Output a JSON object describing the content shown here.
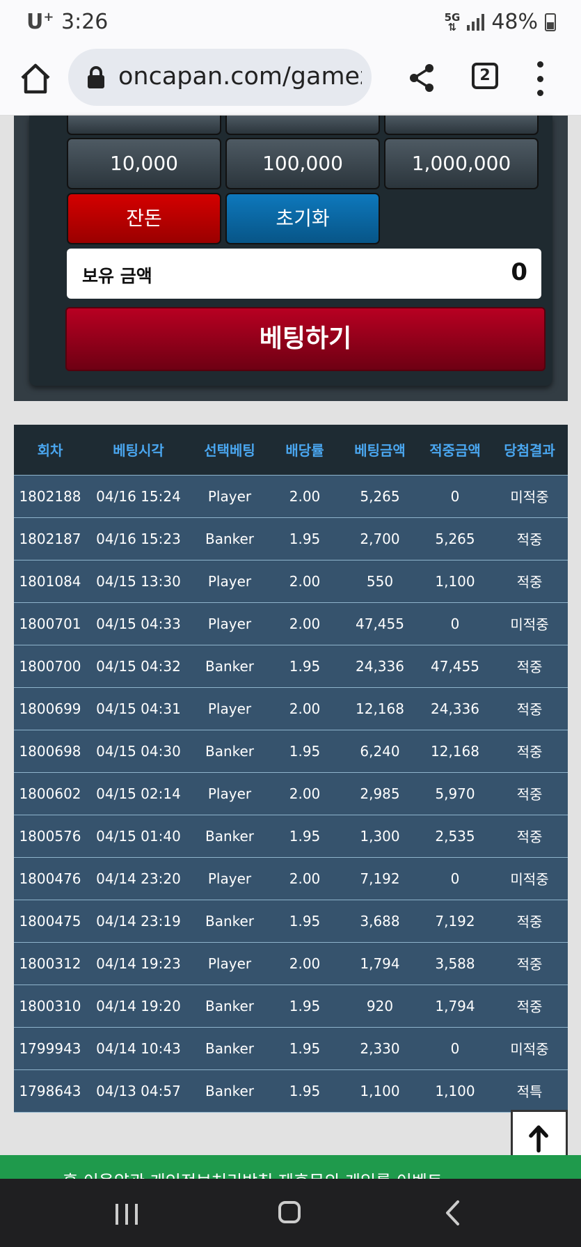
{
  "status_bar": {
    "carrier": "U",
    "carrier_sup": "+",
    "time": "3:26",
    "network_top": "5G",
    "network_bottom": "⇅",
    "battery": "48%",
    "icons": [
      "network-5g-icon",
      "signal-icon",
      "battery-icon"
    ]
  },
  "browser": {
    "url": "oncapan.com/gamezc",
    "tab_count": "2",
    "icons": [
      "home-icon",
      "lock-icon",
      "share-icon",
      "tabs-icon",
      "more-vert-icon"
    ]
  },
  "betting_panel": {
    "chips": [
      "10,000",
      "100,000",
      "1,000,000"
    ],
    "change_label": "잔돈",
    "reset_label": "초기화",
    "balance_label": "보유 금액",
    "balance_value": "0",
    "bet_label": "베팅하기"
  },
  "history": {
    "headers": [
      "회차",
      "베팅시각",
      "선택베팅",
      "배당률",
      "베팅금액",
      "적중금액",
      "당첨결과"
    ],
    "rows": [
      {
        "round": "1802188",
        "time": "04/16 15:24",
        "pick": "Player",
        "odds": "2.00",
        "bet": "5,265",
        "win": "0",
        "result": "미적중"
      },
      {
        "round": "1802187",
        "time": "04/16 15:23",
        "pick": "Banker",
        "odds": "1.95",
        "bet": "2,700",
        "win": "5,265",
        "result": "적중"
      },
      {
        "round": "1801084",
        "time": "04/15 13:30",
        "pick": "Player",
        "odds": "2.00",
        "bet": "550",
        "win": "1,100",
        "result": "적중"
      },
      {
        "round": "1800701",
        "time": "04/15 04:33",
        "pick": "Player",
        "odds": "2.00",
        "bet": "47,455",
        "win": "0",
        "result": "미적중"
      },
      {
        "round": "1800700",
        "time": "04/15 04:32",
        "pick": "Banker",
        "odds": "1.95",
        "bet": "24,336",
        "win": "47,455",
        "result": "적중"
      },
      {
        "round": "1800699",
        "time": "04/15 04:31",
        "pick": "Player",
        "odds": "2.00",
        "bet": "12,168",
        "win": "24,336",
        "result": "적중"
      },
      {
        "round": "1800698",
        "time": "04/15 04:30",
        "pick": "Banker",
        "odds": "1.95",
        "bet": "6,240",
        "win": "12,168",
        "result": "적중"
      },
      {
        "round": "1800602",
        "time": "04/15 02:14",
        "pick": "Player",
        "odds": "2.00",
        "bet": "2,985",
        "win": "5,970",
        "result": "적중"
      },
      {
        "round": "1800576",
        "time": "04/15 01:40",
        "pick": "Banker",
        "odds": "1.95",
        "bet": "1,300",
        "win": "2,535",
        "result": "적중"
      },
      {
        "round": "1800476",
        "time": "04/14 23:20",
        "pick": "Player",
        "odds": "2.00",
        "bet": "7,192",
        "win": "0",
        "result": "미적중"
      },
      {
        "round": "1800475",
        "time": "04/14 23:19",
        "pick": "Banker",
        "odds": "1.95",
        "bet": "3,688",
        "win": "7,192",
        "result": "적중"
      },
      {
        "round": "1800312",
        "time": "04/14 19:23",
        "pick": "Player",
        "odds": "2.00",
        "bet": "1,794",
        "win": "3,588",
        "result": "적중"
      },
      {
        "round": "1800310",
        "time": "04/14 19:20",
        "pick": "Banker",
        "odds": "1.95",
        "bet": "920",
        "win": "1,794",
        "result": "적중"
      },
      {
        "round": "1799943",
        "time": "04/14 10:43",
        "pick": "Banker",
        "odds": "1.95",
        "bet": "2,330",
        "win": "0",
        "result": "미적중"
      },
      {
        "round": "1798643",
        "time": "04/13 04:57",
        "pick": "Banker",
        "odds": "1.95",
        "bet": "1,100",
        "win": "1,100",
        "result": "적특"
      }
    ]
  },
  "scroll_top_icon": "arrow-up-icon",
  "footer": {
    "links_text": "홈  이용약관  개인정보처리방침  제휴문의  게임룰  이벤트"
  },
  "nav_icons": [
    "recents-icon",
    "home-nav-icon",
    "back-icon"
  ],
  "colors": {
    "status_bg": "#fafafc",
    "panel_bg": "#1f2a30",
    "change_btn": "#c00000",
    "reset_btn": "#0a6aa6",
    "bet_btn": "#9a0020",
    "table_header_bg": "#1e2b33",
    "table_header_text": "#4aa6ef",
    "table_row_bg": "#36536d",
    "result_hit": "#f2a71b",
    "result_miss": "#e0121b",
    "footer_green": "#1f9a4c",
    "navbar_bg": "#1f1f21"
  }
}
